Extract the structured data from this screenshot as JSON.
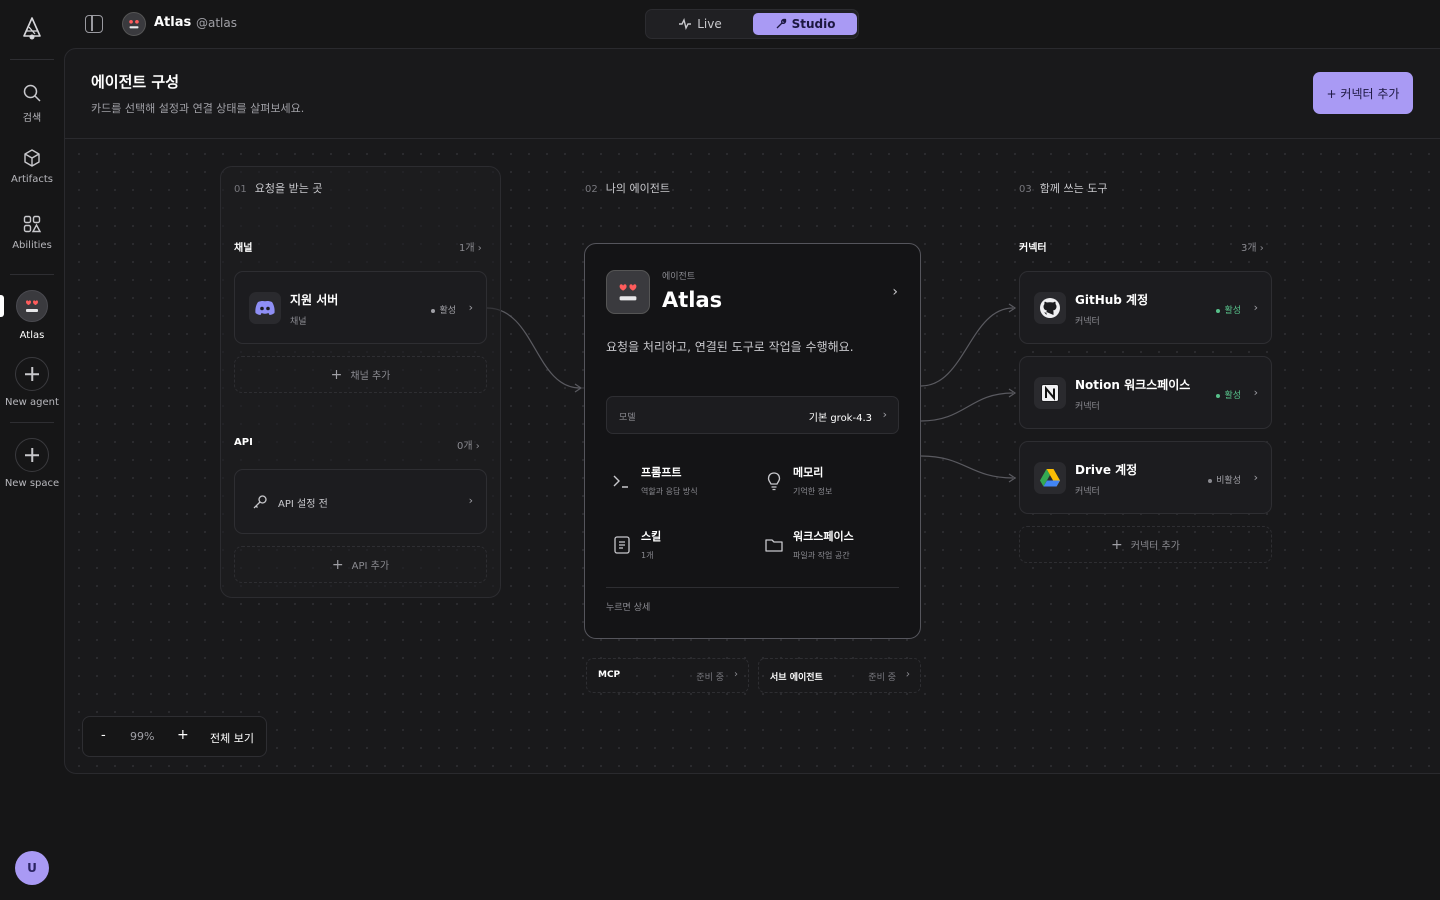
{
  "rail": {
    "items": [
      {
        "label": "검색",
        "icon": "search-icon"
      },
      {
        "label": "Artifacts",
        "icon": "cube-icon"
      },
      {
        "label": "Abilities",
        "icon": "grid-icon"
      },
      {
        "label": "Atlas",
        "icon": "agent-avatar"
      },
      {
        "label": "New agent",
        "icon": "plus-icon"
      },
      {
        "label": "New space",
        "icon": "plus-icon"
      }
    ],
    "user_initial": "U"
  },
  "topbar": {
    "agent_name": "Atlas",
    "agent_handle": "@atlas",
    "modes": [
      {
        "label": "Live",
        "active": false
      },
      {
        "label": "Studio",
        "active": true
      }
    ]
  },
  "header": {
    "title": "에이전트 구성",
    "subtitle": "카드를 선택해 설정과 연결 상태를 살펴보세요.",
    "add_button": "+ 커넥터 추가"
  },
  "columns": [
    {
      "num": "01",
      "label": "요청을 받는 곳"
    },
    {
      "num": "02",
      "label": "나의 에이전트"
    },
    {
      "num": "03",
      "label": "함께 쓰는 도구"
    }
  ],
  "inputs": {
    "channel": {
      "label": "채널",
      "count": "1개",
      "cards": [
        {
          "title": "지원 서버",
          "sub": "채널",
          "status": "활성"
        }
      ],
      "add": "채널 추가"
    },
    "api": {
      "label": "API",
      "count": "0개",
      "card_label": "API 설정 전",
      "add": "API 추가"
    }
  },
  "agent": {
    "kicker": "에이전트",
    "name": "Atlas",
    "description": "요청을 처리하고, 연결된 도구로 작업을 수행해요.",
    "model_label": "모델",
    "model_value": "기본 grok-4.3",
    "features": [
      {
        "title": "프롬프트",
        "sub": "역할과 응답 방식",
        "icon": "terminal-icon"
      },
      {
        "title": "메모리",
        "sub": "기억한 정보",
        "icon": "lightbulb-icon"
      },
      {
        "title": "스킬",
        "sub": "1개",
        "icon": "scroll-icon"
      },
      {
        "title": "워크스페이스",
        "sub": "파일과 작업 공간",
        "icon": "folder-icon"
      }
    ],
    "footer": "누르면 상세",
    "extras": [
      {
        "name": "MCP",
        "status": "준비 중"
      },
      {
        "name": "서브 에이전트",
        "status": "준비 중"
      }
    ]
  },
  "connectors": {
    "label": "커넥터",
    "count": "3개",
    "cards": [
      {
        "title": "GitHub 계정",
        "sub": "커넥터",
        "status": "활성",
        "icon": "github-icon"
      },
      {
        "title": "Notion 워크스페이스",
        "sub": "커넥터",
        "status": "활성",
        "icon": "notion-icon"
      },
      {
        "title": "Drive 계정",
        "sub": "커넥터",
        "status": "비활성",
        "icon": "drive-icon"
      }
    ],
    "add": "커넥터 추가"
  },
  "zoom": {
    "minus": "-",
    "value": "99%",
    "plus": "+",
    "fit": "전체 보기"
  },
  "colors": {
    "accent": "#a99af4",
    "active": "#57c08a",
    "background": "#161617"
  }
}
